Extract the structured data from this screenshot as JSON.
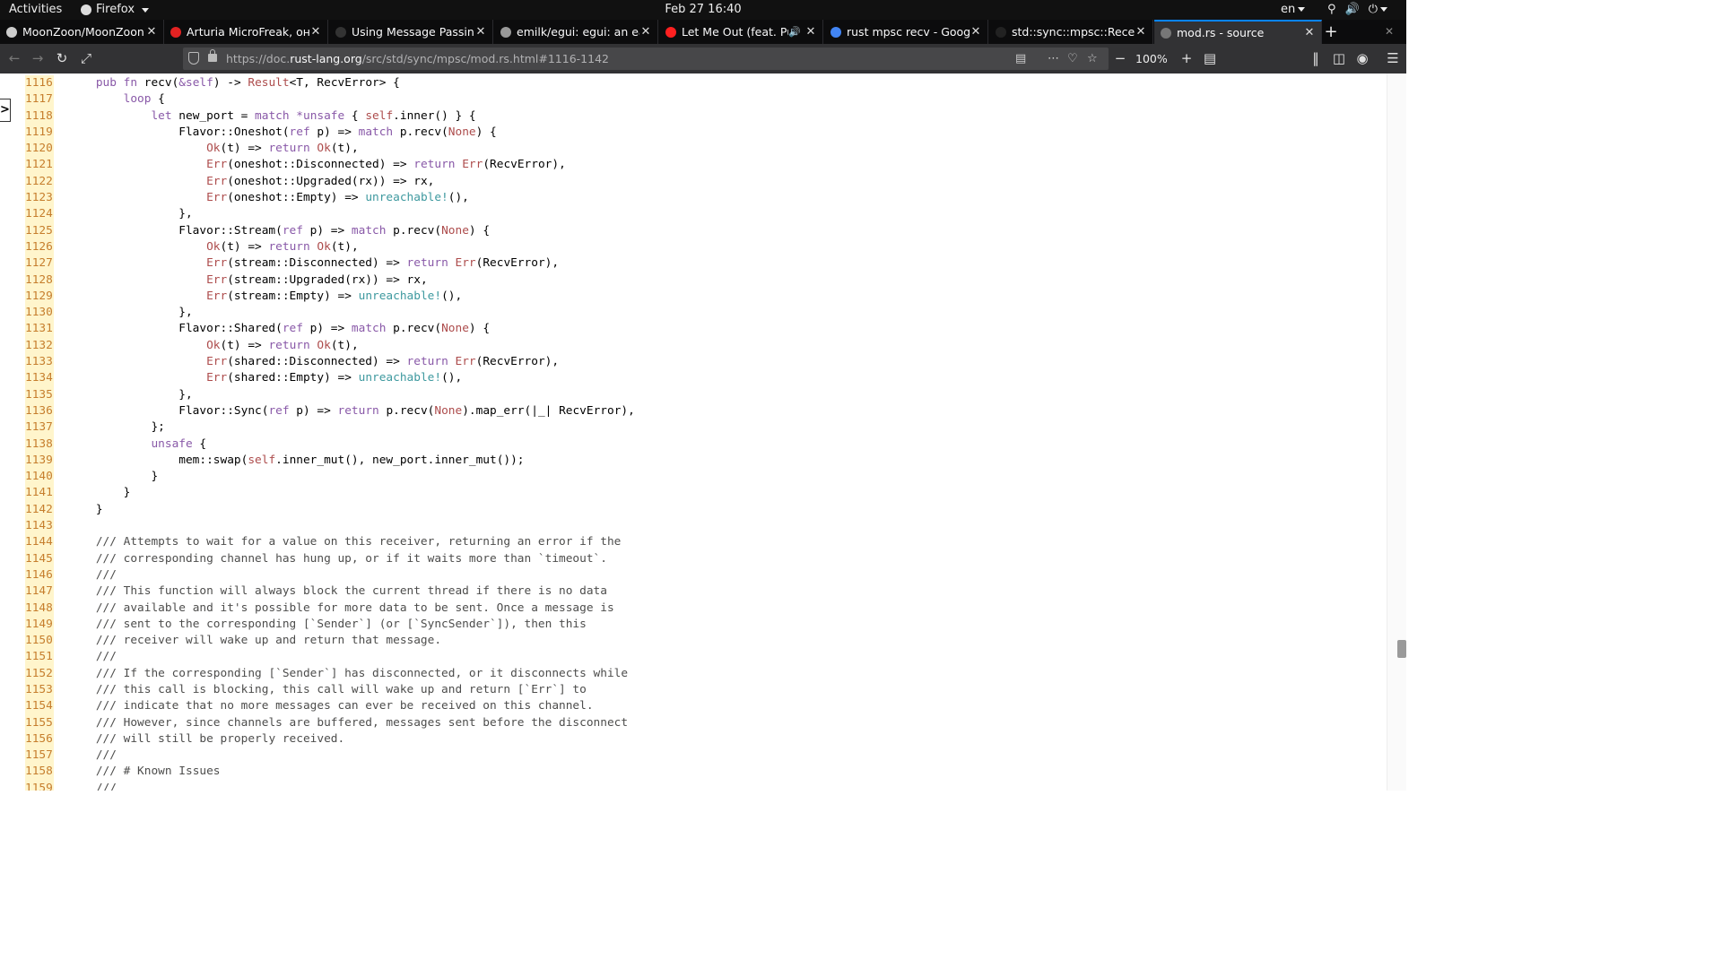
{
  "system_bar": {
    "activities": "Activities",
    "app_name": "Firefox",
    "clock": "Feb 27  16:40",
    "language": "en"
  },
  "tabs": [
    {
      "title": "MoonZoon/MoonZoon: R",
      "favicon_color": "#cccccc",
      "active": false
    },
    {
      "title": "Arturia MicroFreak, онла",
      "favicon_color": "#e22222",
      "active": false
    },
    {
      "title": "Using Message Passing to",
      "favicon_color": "#333333",
      "active": false
    },
    {
      "title": "emilk/egui: egui: an easy-",
      "favicon_color": "#999999",
      "active": false
    },
    {
      "title": "Let Me Out (feat. Push",
      "favicon_color": "#ff2020",
      "active": false,
      "audio": true
    },
    {
      "title": "rust mpsc recv - Google S",
      "favicon_color": "#4285f4",
      "active": false
    },
    {
      "title": "std::sync::mpsc::Receiver",
      "favicon_color": "#222222",
      "active": false
    },
    {
      "title": "mod.rs - source",
      "favicon_color": "#777777",
      "active": true
    }
  ],
  "toolbar": {
    "url_prefix": "https://doc.",
    "url_domain": "rust-lang.org",
    "url_path": "/src/std/sync/mpsc/mod.rs.html#1116-1142",
    "zoom": "100%"
  },
  "code": {
    "lines": [
      {
        "n": "1116",
        "html": "    <span class='kw'>pub fn</span> recv(<span class='kw'>&amp;self</span>) -&gt; <span class='ty'>Result</span>&lt;T, RecvError&gt; {"
      },
      {
        "n": "1117",
        "html": "        <span class='kw'>loop</span> {"
      },
      {
        "n": "1118",
        "html": "            <span class='kw'>let</span> new_port = <span class='kw'>match</span> <span class='kw'>*unsafe</span> { <span class='ty'>self</span>.inner() } {"
      },
      {
        "n": "1119",
        "html": "                Flavor::Oneshot(<span class='kw'>ref</span> p) =&gt; <span class='kw'>match</span> p.recv(<span class='ty'>None</span>) {"
      },
      {
        "n": "1120",
        "html": "                    <span class='ty'>Ok</span>(t) =&gt; <span class='kw'>return</span> <span class='ty'>Ok</span>(t),"
      },
      {
        "n": "1121",
        "html": "                    <span class='ty'>Err</span>(oneshot::Disconnected) =&gt; <span class='kw'>return</span> <span class='ty'>Err</span>(RecvError),"
      },
      {
        "n": "1122",
        "html": "                    <span class='ty'>Err</span>(oneshot::Upgraded(rx)) =&gt; rx,"
      },
      {
        "n": "1123",
        "html": "                    <span class='ty'>Err</span>(oneshot::Empty) =&gt; <span class='mac'>unreachable!</span>(),"
      },
      {
        "n": "1124",
        "html": "                },"
      },
      {
        "n": "1125",
        "html": "                Flavor::Stream(<span class='kw'>ref</span> p) =&gt; <span class='kw'>match</span> p.recv(<span class='ty'>None</span>) {"
      },
      {
        "n": "1126",
        "html": "                    <span class='ty'>Ok</span>(t) =&gt; <span class='kw'>return</span> <span class='ty'>Ok</span>(t),"
      },
      {
        "n": "1127",
        "html": "                    <span class='ty'>Err</span>(stream::Disconnected) =&gt; <span class='kw'>return</span> <span class='ty'>Err</span>(RecvError),"
      },
      {
        "n": "1128",
        "html": "                    <span class='ty'>Err</span>(stream::Upgraded(rx)) =&gt; rx,"
      },
      {
        "n": "1129",
        "html": "                    <span class='ty'>Err</span>(stream::Empty) =&gt; <span class='mac'>unreachable!</span>(),"
      },
      {
        "n": "1130",
        "html": "                },"
      },
      {
        "n": "1131",
        "html": "                Flavor::Shared(<span class='kw'>ref</span> p) =&gt; <span class='kw'>match</span> p.recv(<span class='ty'>None</span>) {"
      },
      {
        "n": "1132",
        "html": "                    <span class='ty'>Ok</span>(t) =&gt; <span class='kw'>return</span> <span class='ty'>Ok</span>(t),"
      },
      {
        "n": "1133",
        "html": "                    <span class='ty'>Err</span>(shared::Disconnected) =&gt; <span class='kw'>return</span> <span class='ty'>Err</span>(RecvError),"
      },
      {
        "n": "1134",
        "html": "                    <span class='ty'>Err</span>(shared::Empty) =&gt; <span class='mac'>unreachable!</span>(),"
      },
      {
        "n": "1135",
        "html": "                },"
      },
      {
        "n": "1136",
        "html": "                Flavor::Sync(<span class='kw'>ref</span> p) =&gt; <span class='kw'>return</span> p.recv(<span class='ty'>None</span>).map_err(|_| RecvError),"
      },
      {
        "n": "1137",
        "html": "            };"
      },
      {
        "n": "1138",
        "html": "            <span class='kw'>unsafe</span> {"
      },
      {
        "n": "1139",
        "html": "                mem::swap(<span class='ty'>self</span>.inner_mut(), new_port.inner_mut());"
      },
      {
        "n": "1140",
        "html": "            }"
      },
      {
        "n": "1141",
        "html": "        }"
      },
      {
        "n": "1142",
        "html": "    }"
      },
      {
        "n": "1143",
        "html": ""
      },
      {
        "n": "1144",
        "html": "    <span class='cm'>/// Attempts to wait for a value on this receiver, returning an error if the</span>"
      },
      {
        "n": "1145",
        "html": "    <span class='cm'>/// corresponding channel has hung up, or if it waits more than `timeout`.</span>"
      },
      {
        "n": "1146",
        "html": "    <span class='cm'>///</span>"
      },
      {
        "n": "1147",
        "html": "    <span class='cm'>/// This function will always block the current thread if there is no data</span>"
      },
      {
        "n": "1148",
        "html": "    <span class='cm'>/// available and it's possible for more data to be sent. Once a message is</span>"
      },
      {
        "n": "1149",
        "html": "    <span class='cm'>/// sent to the corresponding [`Sender`] (or [`SyncSender`]), then this</span>"
      },
      {
        "n": "1150",
        "html": "    <span class='cm'>/// receiver will wake up and return that message.</span>"
      },
      {
        "n": "1151",
        "html": "    <span class='cm'>///</span>"
      },
      {
        "n": "1152",
        "html": "    <span class='cm'>/// If the corresponding [`Sender`] has disconnected, or it disconnects while</span>"
      },
      {
        "n": "1153",
        "html": "    <span class='cm'>/// this call is blocking, this call will wake up and return [`Err`] to</span>"
      },
      {
        "n": "1154",
        "html": "    <span class='cm'>/// indicate that no more messages can ever be received on this channel.</span>"
      },
      {
        "n": "1155",
        "html": "    <span class='cm'>/// However, since channels are buffered, messages sent before the disconnect</span>"
      },
      {
        "n": "1156",
        "html": "    <span class='cm'>/// will still be properly received.</span>"
      },
      {
        "n": "1157",
        "html": "    <span class='cm'>///</span>"
      },
      {
        "n": "1158",
        "html": "    <span class='cm'>/// # Known Issues</span>"
      },
      {
        "n": "1159",
        "html": "    <span class='cm'>///</span>"
      }
    ]
  },
  "sidebar_toggle": ">"
}
